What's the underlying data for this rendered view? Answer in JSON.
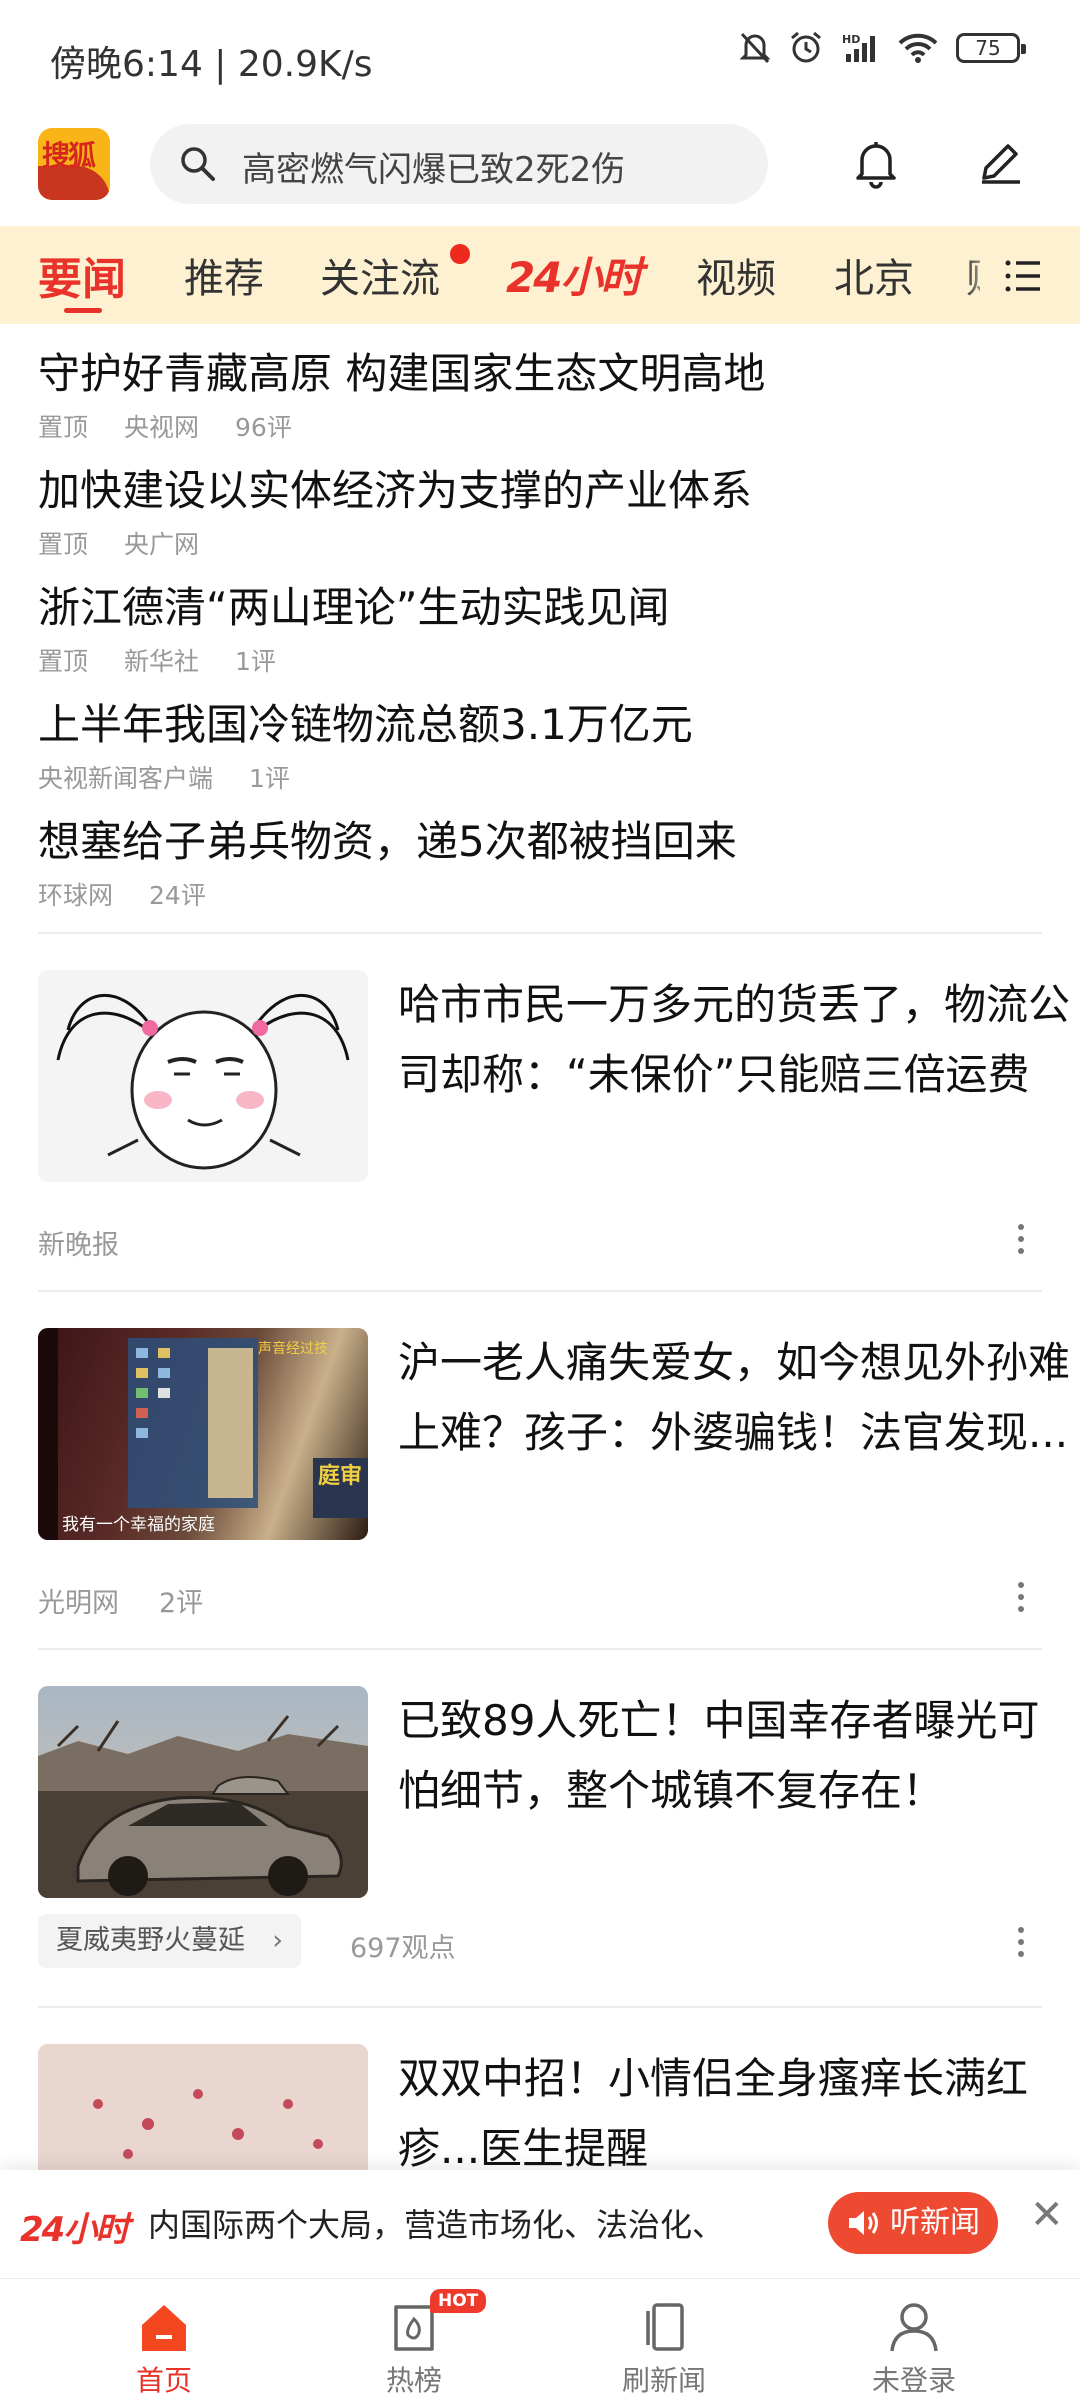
{
  "status": {
    "time": "傍晚6:14 | 20.9K/s",
    "battery": "75",
    "icons": [
      "mute-bell-icon",
      "alarm-icon",
      "hd-signal-icon",
      "wifi-icon",
      "battery-icon"
    ]
  },
  "header": {
    "logo_text": "搜狐",
    "search_placeholder": "高密燃气闪爆已致2死2伤",
    "icons": [
      "search-icon",
      "bell-icon",
      "edit-icon"
    ]
  },
  "tabs": [
    {
      "label": "要闻",
      "active": true
    },
    {
      "label": "推荐"
    },
    {
      "label": "关注流",
      "dot": true
    },
    {
      "label": "24小时",
      "special": true
    },
    {
      "label": "视频"
    },
    {
      "label": "北京"
    },
    {
      "label": "财"
    }
  ],
  "top_news": [
    {
      "title": "守护好青藏高原 构建国家生态文明高地",
      "tag": "置顶",
      "source": "央视网",
      "comments": "96评"
    },
    {
      "title": "加快建设以实体经济为支撑的产业体系",
      "tag": "置顶",
      "source": "央广网",
      "comments": ""
    },
    {
      "title": "浙江德清“两山理论”生动实践见闻",
      "tag": "置顶",
      "source": "新华社",
      "comments": "1评"
    },
    {
      "title": "上半年我国冷链物流总额3.1万亿元",
      "tag": "",
      "source": "央视新闻客户端",
      "comments": "1评"
    },
    {
      "title": "想塞给子弟兵物资，递5次都被挡回来",
      "tag": "",
      "source": "环球网",
      "comments": "24评"
    }
  ],
  "cards": [
    {
      "title": "哈市市民一万多元的货丢了，物流公司却称：“未保价”只能赔三倍运费",
      "source": "新晚报",
      "comments": ""
    },
    {
      "title": "沪一老人痛失爱女，如今想见外孙难上难？孩子：外婆骗钱！法官发现...",
      "source": "光明网",
      "comments": "2评",
      "thumb_caption": "我有一个幸福的家庭",
      "thumb_overlay": "庭审"
    },
    {
      "title": "已致89人死亡！中国幸存者曝光可怕细节，整个城镇不复存在！",
      "topic_tag": "夏威夷野火蔓延",
      "views": "697观点"
    },
    {
      "title": "双双中招！小情侣全身瘙痒长满红疹...医生提醒"
    }
  ],
  "listen_bar": {
    "logo": "24小时",
    "text": "内国际两个大局，营造市场化、法治化、",
    "button": "听新闻"
  },
  "bottom_nav": [
    {
      "label": "首页",
      "icon": "home-icon",
      "active": true
    },
    {
      "label": "热榜",
      "icon": "trending-icon",
      "badge": "HOT"
    },
    {
      "label": "刷新闻",
      "icon": "cards-icon"
    },
    {
      "label": "未登录",
      "icon": "user-icon"
    }
  ],
  "colors": {
    "accent": "#e8322a",
    "tab_bar": "#fdf1d1"
  }
}
